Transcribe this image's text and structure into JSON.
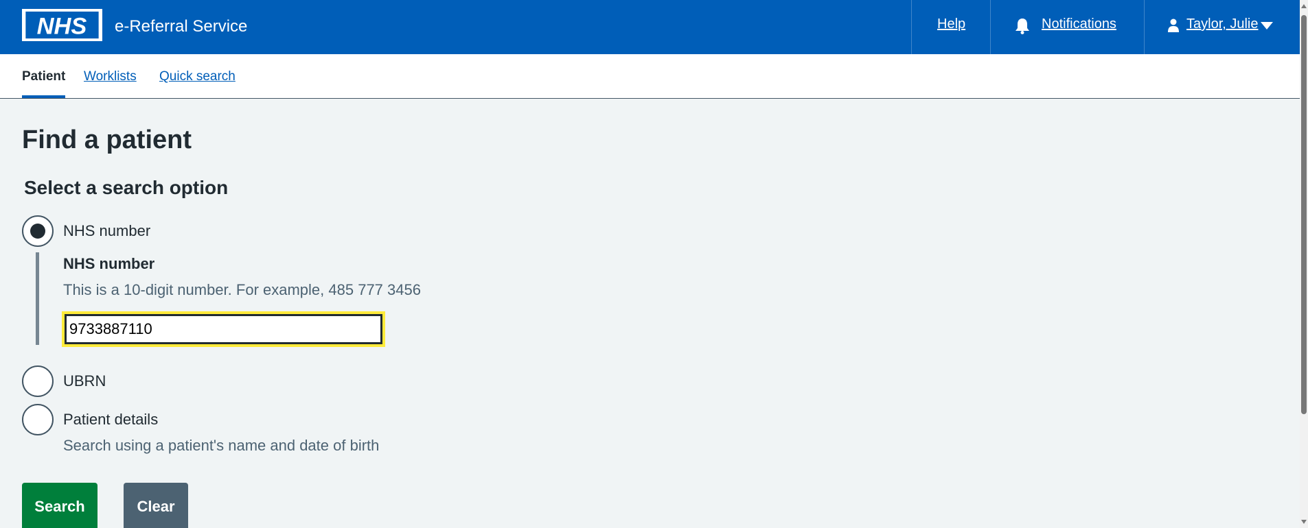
{
  "header": {
    "logo_text": "NHS",
    "service_name": "e-Referral Service",
    "help_label": "Help",
    "notifications_label": "Notifications",
    "user_label": "Taylor, Julie"
  },
  "nav": {
    "items": [
      {
        "label": "Patient",
        "active": true
      },
      {
        "label": "Worklists",
        "active": false
      },
      {
        "label": "Quick search",
        "active": false
      }
    ]
  },
  "main": {
    "title": "Find a patient",
    "legend": "Select a search option",
    "options": [
      {
        "label": "NHS number",
        "selected": true
      },
      {
        "label": "UBRN",
        "selected": false
      },
      {
        "label": "Patient details",
        "selected": false,
        "hint": "Search using a patient's name and date of birth"
      }
    ],
    "nhs_field": {
      "label": "NHS number",
      "hint": "This is a 10-digit number. For example, 485 777 3456",
      "value": "9733887110"
    },
    "buttons": {
      "search_label": "Search",
      "clear_label": "Clear"
    }
  },
  "colors": {
    "header_blue": "#005eb8",
    "search_green": "#007f3b",
    "clear_grey": "#4c6272",
    "focus_yellow": "#ffeb3b",
    "page_bg": "#f0f4f5"
  },
  "icons": {
    "notifications": "bell-icon",
    "user": "person-icon",
    "user_menu": "caret-down-icon"
  }
}
